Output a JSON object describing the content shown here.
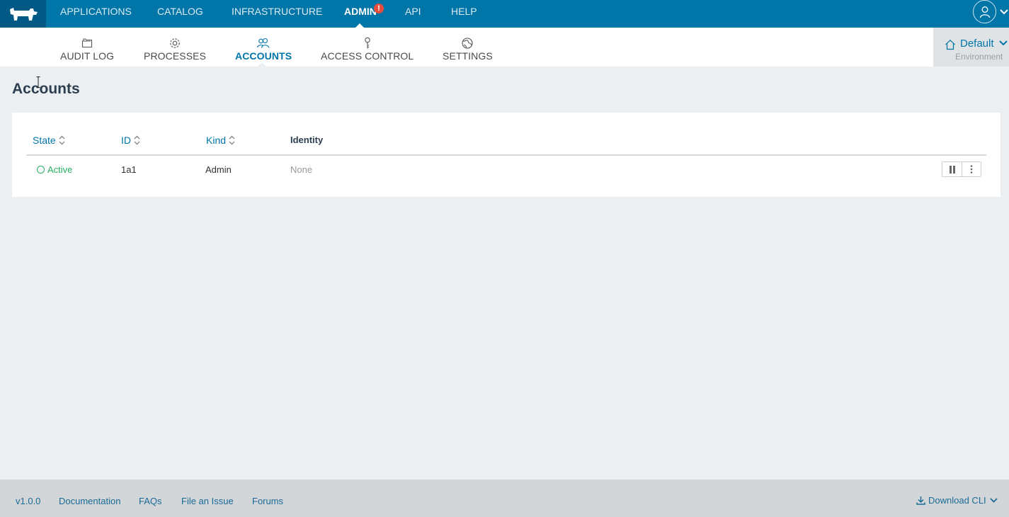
{
  "topnav": {
    "logo_icon": "rancher-cow-icon",
    "items": [
      {
        "label": "APPLICATIONS"
      },
      {
        "label": "CATALOG"
      },
      {
        "label": "INFRASTRUCTURE"
      },
      {
        "label": "ADMIN",
        "active": true,
        "badge": "!"
      },
      {
        "label": "API"
      },
      {
        "label": "HELP"
      }
    ]
  },
  "subnav": {
    "items": [
      {
        "label": "AUDIT LOG",
        "icon": "folder-icon"
      },
      {
        "label": "PROCESSES",
        "icon": "gear-icon"
      },
      {
        "label": "ACCOUNTS",
        "icon": "users-icon",
        "active": true
      },
      {
        "label": "ACCESS CONTROL",
        "icon": "key-icon"
      },
      {
        "label": "SETTINGS",
        "icon": "globe-icon"
      }
    ]
  },
  "environment": {
    "name": "Default",
    "sublabel": "Environment"
  },
  "page": {
    "title": "Accounts"
  },
  "table": {
    "columns": [
      "State",
      "ID",
      "Kind",
      "Identity"
    ],
    "rows": [
      {
        "state": "Active",
        "id": "1a1",
        "kind": "Admin",
        "identity": "None"
      }
    ]
  },
  "footer": {
    "version": "v1.0.0",
    "links": [
      "Documentation",
      "FAQs",
      "File an Issue",
      "Forums"
    ],
    "download": "Download CLI"
  },
  "colors": {
    "brand": "#0075a8",
    "active_state": "#27ae60",
    "alert": "#e74c3c"
  }
}
